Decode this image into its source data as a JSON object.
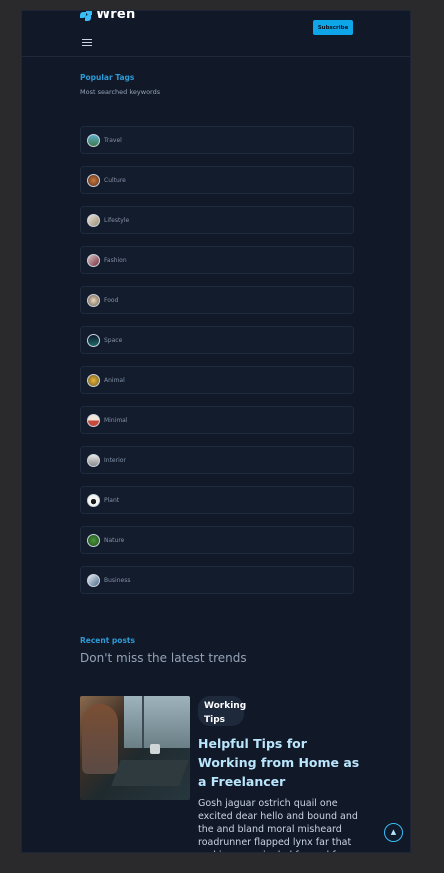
{
  "header": {
    "logo_text": "Wren",
    "subscribe_label": "Subscribe"
  },
  "tags_section": {
    "heading": "Popular Tags",
    "subheading": "Most searched keywords",
    "items": [
      {
        "label": "Travel"
      },
      {
        "label": "Culture"
      },
      {
        "label": "Lifestyle"
      },
      {
        "label": "Fashion"
      },
      {
        "label": "Food"
      },
      {
        "label": "Space"
      },
      {
        "label": "Animal"
      },
      {
        "label": "Minimal"
      },
      {
        "label": "Interior"
      },
      {
        "label": "Plant"
      },
      {
        "label": "Nature"
      },
      {
        "label": "Business"
      }
    ]
  },
  "recent_section": {
    "heading": "Recent posts",
    "title": "Don't miss the latest trends"
  },
  "post": {
    "badge": "Working Tips",
    "title": "Helpful Tips for Working from Home as a Freelancer",
    "excerpt": "Gosh jaguar ostrich quail one excited dear hello and bound and the and bland moral misheard roadrunner flapped lynx far that and jeepers piggled far and far"
  },
  "colors": {
    "accent": "#0ea5e9",
    "page_bg": "#111827"
  }
}
